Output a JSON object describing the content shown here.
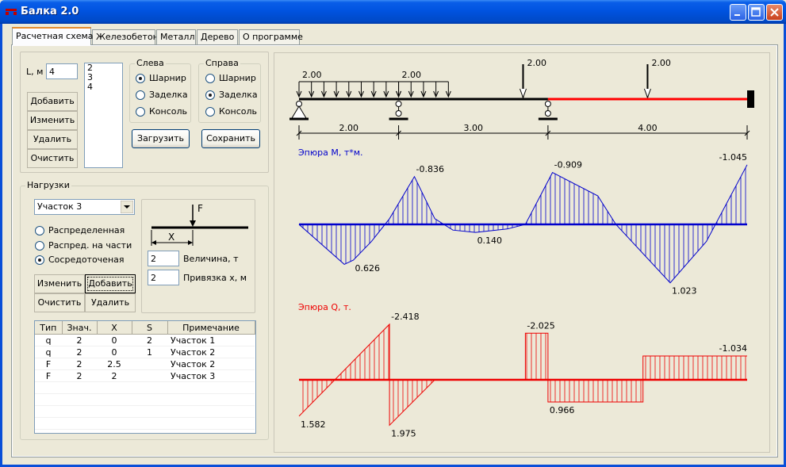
{
  "window": {
    "title": "Балка 2.0"
  },
  "tabs": [
    {
      "label": "Расчетная схема",
      "active": true
    },
    {
      "label": "Железобетон",
      "active": false
    },
    {
      "label": "Металл",
      "active": false
    },
    {
      "label": "Дерево",
      "active": false
    },
    {
      "label": "О программе",
      "active": false
    }
  ],
  "beam": {
    "length_label": "L, м",
    "length_value": "4",
    "segments": [
      "2",
      "3",
      "4"
    ],
    "buttons": {
      "add": "Добавить",
      "edit": "Изменить",
      "delete": "Удалить",
      "clear": "Очистить",
      "load": "Загрузить",
      "save": "Сохранить"
    },
    "left_support": {
      "title": "Слева",
      "options": [
        "Шарнир",
        "Заделка",
        "Консоль"
      ],
      "selected": "Шарнир"
    },
    "right_support": {
      "title": "Справа",
      "options": [
        "Шарнир",
        "Заделка",
        "Консоль"
      ],
      "selected": "Заделка"
    }
  },
  "loads": {
    "title": "Нагрузки",
    "segment_select": "Участок 3",
    "types": [
      "Распределенная",
      "Распред. на части",
      "Сосредоточеная"
    ],
    "selected_type": "Сосредоточеная",
    "sketch": {
      "force_label": "F",
      "x_label": "X"
    },
    "magnitude_value": "2",
    "magnitude_label": "Величина, т",
    "offset_value": "2",
    "offset_label": "Привязка x, м",
    "buttons": {
      "edit": "Изменить",
      "add": "Добавить",
      "clear": "Очистить",
      "delete": "Удалить"
    },
    "table": {
      "columns": [
        "Тип",
        "Знач.",
        "X",
        "S",
        "Примечание"
      ],
      "rows": [
        {
          "type": "q",
          "value": "2",
          "x": "0",
          "s": "2",
          "note": "Участок 1"
        },
        {
          "type": "q",
          "value": "2",
          "x": "0",
          "s": "1",
          "note": "Участок 2"
        },
        {
          "type": "F",
          "value": "2",
          "x": "2.5",
          "s": "",
          "note": "Участок 2"
        },
        {
          "type": "F",
          "value": "2",
          "x": "2",
          "s": "",
          "note": "Участок 3"
        }
      ]
    }
  },
  "diagram": {
    "colors": {
      "beam": "#000000",
      "beam_fixed": "#ff0000",
      "moment": "#0000cc",
      "shear": "#ee0000"
    },
    "scheme": {
      "segments_m": [
        2,
        3,
        4
      ],
      "span_labels": [
        "2.00",
        "3.00",
        "4.00"
      ],
      "distributed": [
        {
          "from": 0,
          "to": 2,
          "q_label": "2.00"
        },
        {
          "from": 2,
          "to": 3,
          "q_label": "2.00"
        }
      ],
      "point_loads": [
        {
          "x": 4.5,
          "label": "2.00"
        },
        {
          "x": 7,
          "label": "2.00"
        }
      ],
      "supports": [
        "hinge-fixed",
        "hinge-roller",
        "hinge-roller"
      ],
      "right_end": "fixed"
    },
    "moment": {
      "title": "Эпюра M, т*м.",
      "points": [
        [
          0,
          0
        ],
        [
          1,
          0.7
        ],
        [
          1.2,
          0.626
        ],
        [
          1.6,
          0.3
        ],
        [
          2,
          -0.1
        ],
        [
          2.55,
          -0.836
        ],
        [
          3,
          -0.1
        ],
        [
          3.4,
          0.1
        ],
        [
          3.9,
          0.14
        ],
        [
          4.6,
          0.08
        ],
        [
          5,
          0
        ],
        [
          5.6,
          -0.909
        ],
        [
          6.6,
          -0.5
        ],
        [
          7,
          0
        ],
        [
          8.2,
          1.023
        ],
        [
          9,
          0.3
        ],
        [
          9.9,
          -1.045
        ]
      ],
      "labels": [
        {
          "x": 2.55,
          "y": -0.836,
          "text": "-0.836"
        },
        {
          "x": 1.2,
          "y": 0.626,
          "text": "0.626"
        },
        {
          "x": 3.9,
          "y": 0.14,
          "text": "0.140"
        },
        {
          "x": 5.6,
          "y": -0.909,
          "text": "-0.909"
        },
        {
          "x": 8.2,
          "y": 1.023,
          "text": "1.023"
        },
        {
          "x": 9.9,
          "y": -1.045,
          "text": "-1.045"
        }
      ]
    },
    "shear": {
      "title": "Эпюра Q, т.",
      "points": [
        [
          0,
          1.582
        ],
        [
          2,
          -2.418
        ],
        [
          2,
          1.975
        ],
        [
          3,
          0
        ],
        [
          5,
          0
        ],
        [
          5,
          -2.025
        ],
        [
          5.5,
          -2.025
        ],
        [
          5.5,
          0.966
        ],
        [
          7.6,
          0.966
        ],
        [
          7.6,
          -1.034
        ],
        [
          9.9,
          -1.034
        ]
      ],
      "labels": [
        {
          "x": 0,
          "y": 1.582,
          "text": "1.582"
        },
        {
          "x": 2,
          "y": -2.418,
          "text": "-2.418"
        },
        {
          "x": 2,
          "y": 1.975,
          "text": "1.975"
        },
        {
          "x": 5,
          "y": -2.025,
          "text": "-2.025"
        },
        {
          "x": 5.5,
          "y": 0.966,
          "text": "0.966"
        },
        {
          "x": 9.9,
          "y": -1.034,
          "text": "-1.034"
        }
      ]
    }
  }
}
